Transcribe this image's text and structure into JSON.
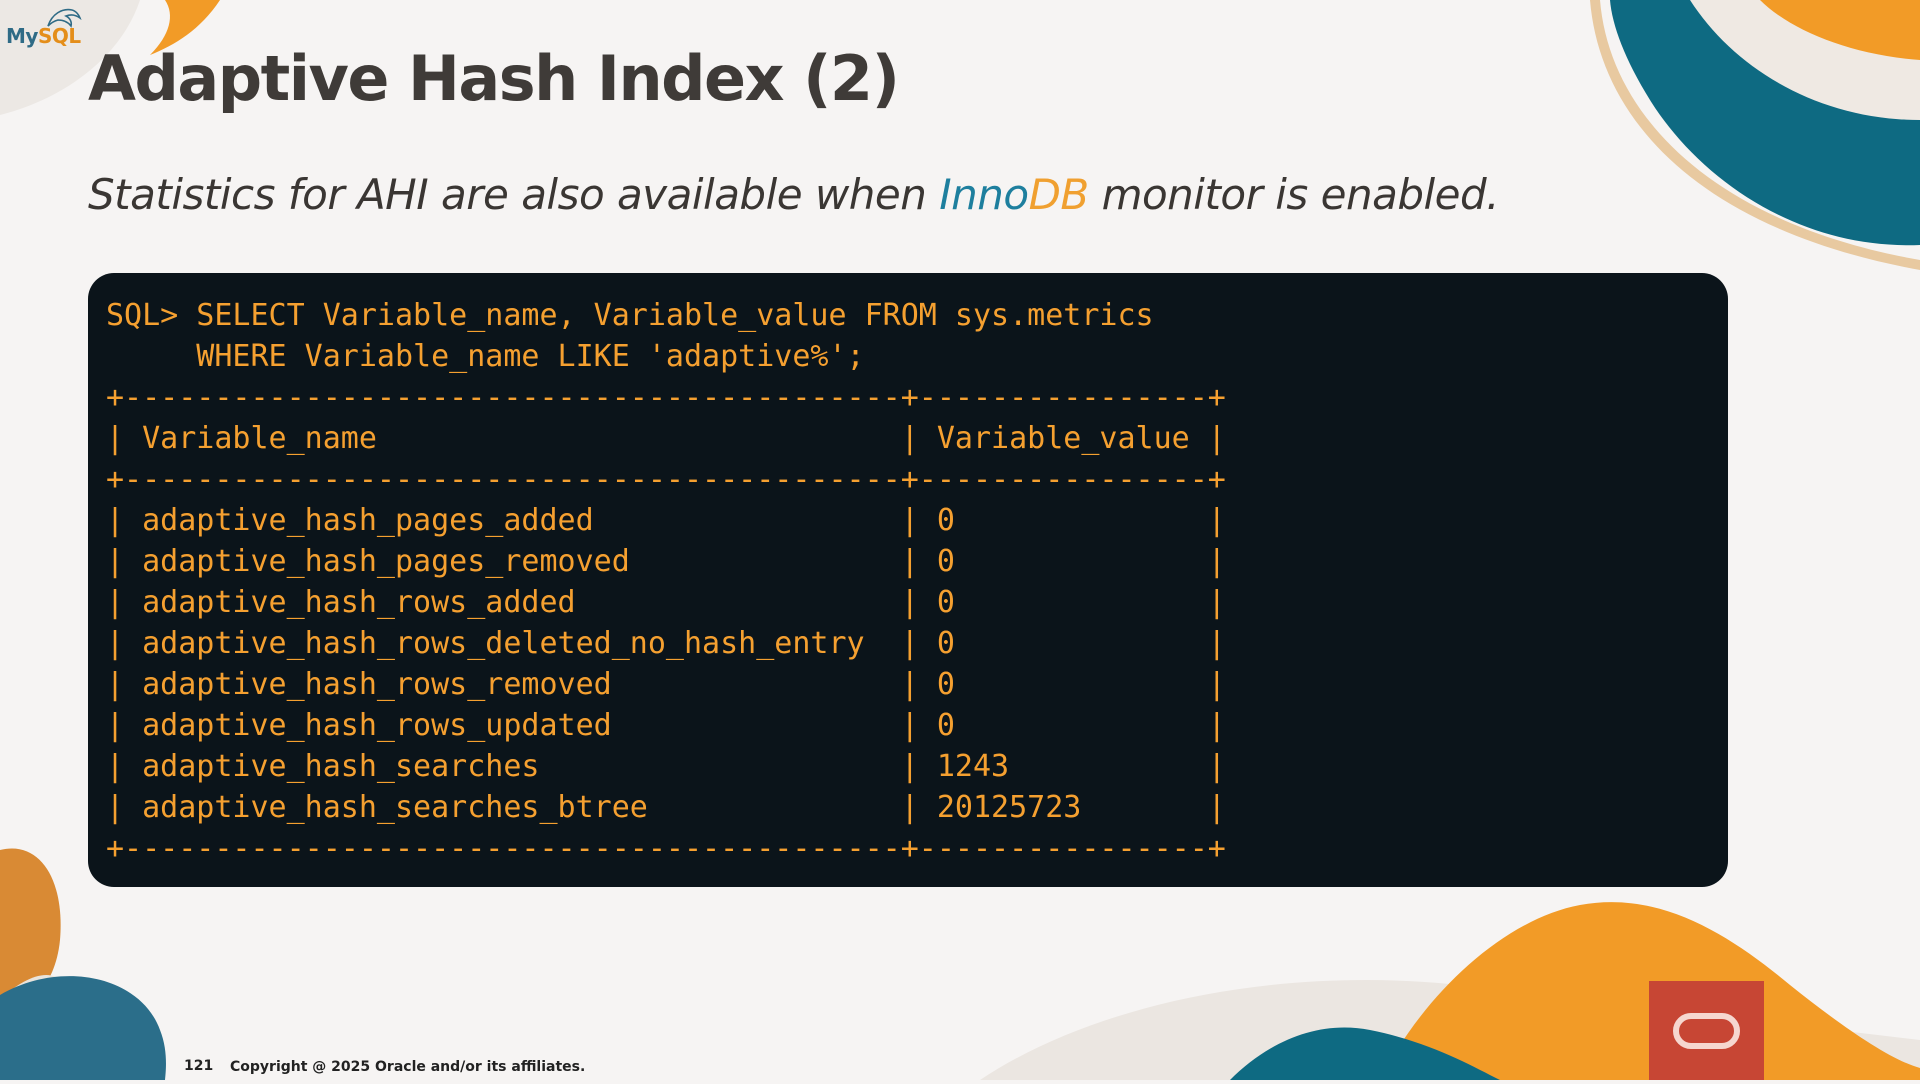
{
  "logo": {
    "part1": "My",
    "part2": "SQL"
  },
  "title": "Adaptive Hash Index (2)",
  "subtitle": {
    "before": "Statistics for AHI are also available when ",
    "inno": "Inno",
    "db": "DB",
    "after": " monitor is enabled."
  },
  "terminal": {
    "text": "SQL> SELECT Variable_name, Variable_value FROM sys.metrics\n     WHERE Variable_name LIKE 'adaptive%';\n+-------------------------------------------+----------------+\n| Variable_name                             | Variable_value |\n+-------------------------------------------+----------------+\n| adaptive_hash_pages_added                 | 0              |\n| adaptive_hash_pages_removed               | 0              |\n| adaptive_hash_rows_added                  | 0              |\n| adaptive_hash_rows_deleted_no_hash_entry  | 0              |\n| adaptive_hash_rows_removed                | 0              |\n| adaptive_hash_rows_updated                | 0              |\n| adaptive_hash_searches                    | 1243           |\n| adaptive_hash_searches_btree              | 20125723       |\n+-------------------------------------------+----------------+"
  },
  "footer": {
    "page_number": "121",
    "copyright": "Copyright @ 2025 Oracle and/or its affiliates."
  },
  "colors": {
    "title": "#3f3b38",
    "terminal_bg": "#0b141a",
    "terminal_text": "#f5a030",
    "inno": "#1e7f9e",
    "db": "#f0a030",
    "oracle_red": "#c74634",
    "teal": "#0e6a82",
    "orange": "#f29b27"
  },
  "icons": [
    "dolphin-icon",
    "oracle-logo-icon"
  ]
}
